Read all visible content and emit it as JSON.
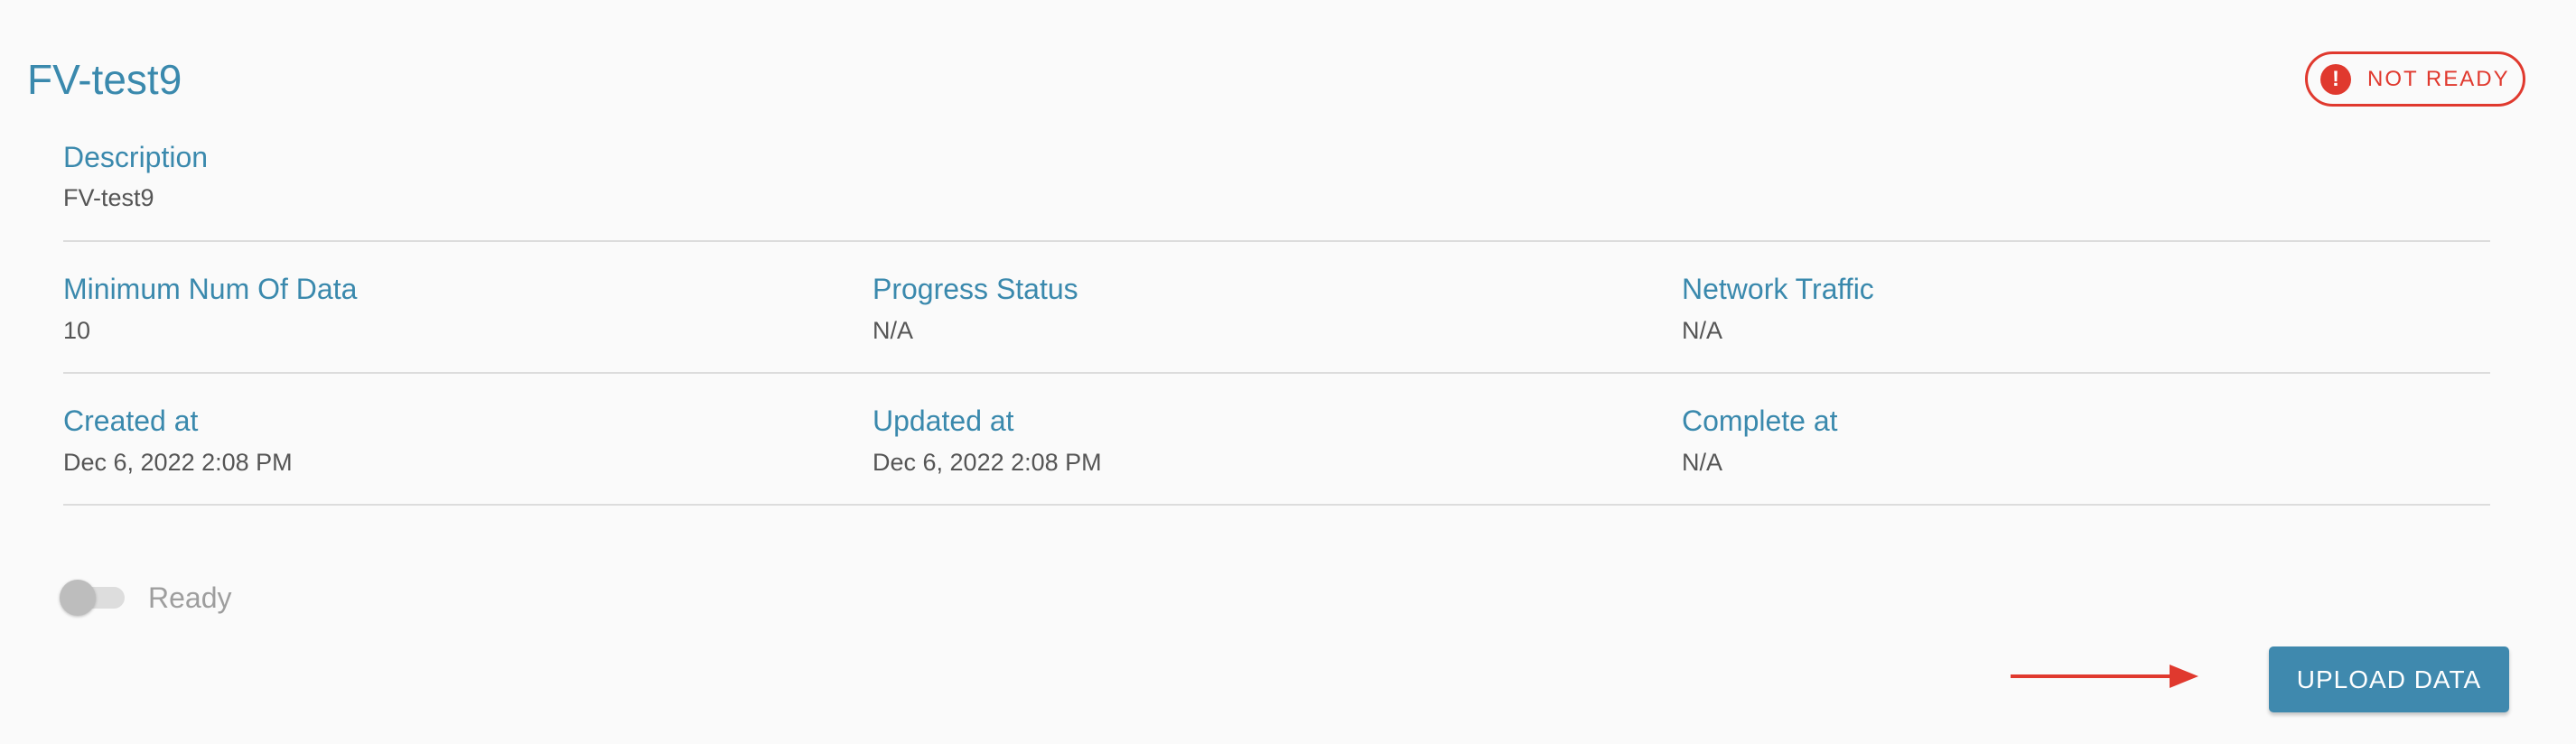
{
  "header": {
    "title": "FV-test9",
    "status_badge": {
      "icon": "exclamation-icon",
      "label": "NOT READY",
      "color": "#e0392e"
    }
  },
  "details": {
    "description": {
      "label": "Description",
      "value": "FV-test9"
    },
    "row1": [
      {
        "label": "Minimum Num Of Data",
        "value": "10"
      },
      {
        "label": "Progress Status",
        "value": "N/A"
      },
      {
        "label": "Network Traffic",
        "value": "N/A"
      }
    ],
    "row2": [
      {
        "label": "Created at",
        "value": "Dec 6, 2022 2:08 PM"
      },
      {
        "label": "Updated at",
        "value": "Dec 6, 2022 2:08 PM"
      },
      {
        "label": "Complete at",
        "value": "N/A"
      }
    ]
  },
  "ready_toggle": {
    "label": "Ready",
    "checked": false
  },
  "actions": {
    "upload_label": "UPLOAD DATA",
    "arrow_icon": "arrow-right-icon",
    "arrow_color": "#e0392e"
  },
  "colors": {
    "accent": "#3a89ad",
    "button": "#3f89ae",
    "error": "#e0392e"
  }
}
